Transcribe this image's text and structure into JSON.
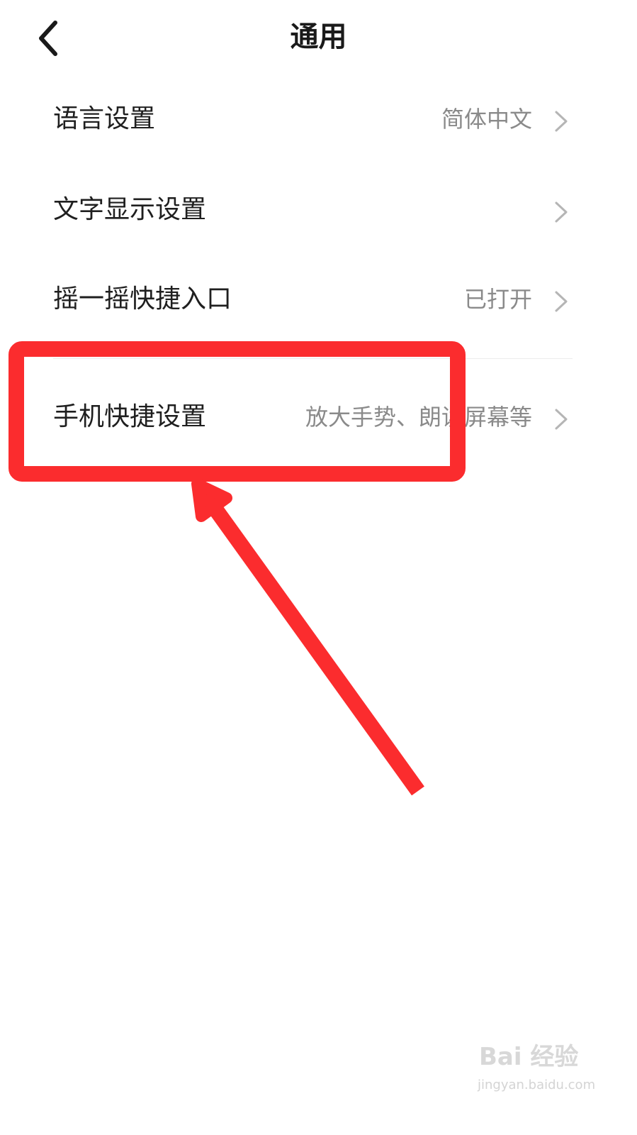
{
  "header": {
    "title": "通用",
    "back_icon": "chevron-left-icon"
  },
  "settings": [
    {
      "label": "语言设置",
      "value": "简体中文",
      "icon": "chevron-right-icon"
    },
    {
      "label": "文字显示设置",
      "value": "",
      "icon": "chevron-right-icon"
    },
    {
      "label": "摇一摇快捷入口",
      "value": "已打开",
      "icon": "chevron-right-icon"
    },
    {
      "label": "手机快捷设置",
      "value": "放大手势、朗读屏幕等",
      "icon": "chevron-right-icon"
    }
  ],
  "annotation": {
    "color": "#fb2c2e",
    "highlight_target": "手机快捷设置",
    "arrow_icon": "arrow-up-left-icon"
  },
  "watermark": {
    "logo": "Bai 经验",
    "url": "jingyan.baidu.com"
  }
}
